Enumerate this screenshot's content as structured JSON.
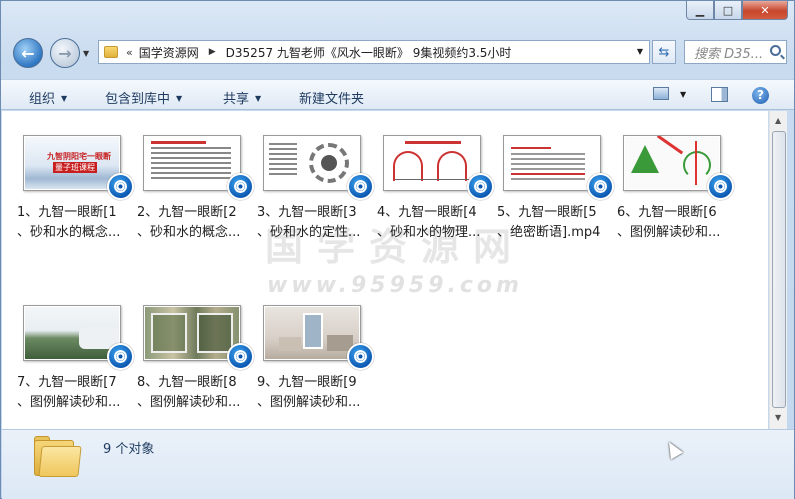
{
  "window": {
    "controls": {
      "minimize": "▁",
      "maximize": "□",
      "close": "✕"
    }
  },
  "nav": {
    "back_icon": "back-arrow-icon",
    "forward_icon": "forward-arrow-icon",
    "address_prefix": "«",
    "breadcrumbs": [
      "国学资源网",
      "D35257 九智老师《风水一眼断》 9集视频约3.5小时"
    ],
    "search_placeholder": "搜索 D35..."
  },
  "toolbar": {
    "organize": "组织",
    "include_library": "包含到库中",
    "share": "共享",
    "new_folder": "新建文件夹"
  },
  "watermark": {
    "line1": "国学资源网",
    "line2": "www.95959.com"
  },
  "files": [
    {
      "line1": "1、九智一眼断[1",
      "line2": "、砂和水的概念..."
    },
    {
      "line1": "2、九智一眼断[2",
      "line2": "、砂和水的概念..."
    },
    {
      "line1": "3、九智一眼断[3",
      "line2": "、砂和水的定性..."
    },
    {
      "line1": "4、九智一眼断[4",
      "line2": "、砂和水的物理..."
    },
    {
      "line1": "5、九智一眼断[5",
      "line2": "、绝密断语].mp4"
    },
    {
      "line1": "6、九智一眼断[6",
      "line2": "、图例解读砂和..."
    },
    {
      "line1": "7、九智一眼断[7",
      "line2": "、图例解读砂和..."
    },
    {
      "line1": "8、九智一眼断[8",
      "line2": "、图例解读砂和..."
    },
    {
      "line1": "9、九智一眼断[9",
      "line2": "、图例解读砂和..."
    }
  ],
  "thumb_titles": {
    "t1_line1": "九智阴阳宅一眼断",
    "t1_line2": "量子班课程"
  },
  "status": {
    "count": "9 个对象"
  },
  "colors": {
    "accent": "#1f5fb0",
    "toolbar_text": "#1e3a5f"
  }
}
